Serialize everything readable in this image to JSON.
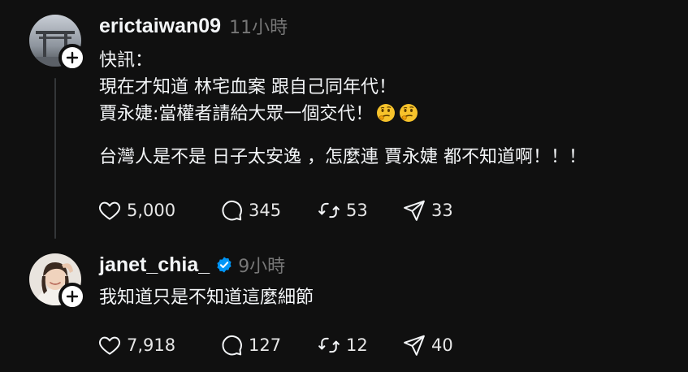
{
  "colors": {
    "background": "#101010",
    "text_primary": "#f3f5f7",
    "text_secondary": "#777777",
    "verified_badge": "#0095f6",
    "thread_line": "#333638"
  },
  "posts": [
    {
      "username": "erictaiwan09",
      "timestamp": "11小時",
      "verified": false,
      "avatar_icon": "torii-gate-photo",
      "lines": [
        "快訊：",
        "現在才知道 林宅血案 跟自己同年代！",
        "賈永婕:當權者請給大眾一個交代！",
        "",
        "台灣人是不是 日子太安逸 ，怎麼連 賈永婕 都不知道啊！！！"
      ],
      "emoji": [
        "thinking-face",
        "thinking-face"
      ],
      "likes": "5,000",
      "comments": "345",
      "reposts": "53",
      "shares": "33"
    },
    {
      "username": "janet_chia_",
      "timestamp": "9小時",
      "verified": true,
      "avatar_icon": "user-photo",
      "lines": [
        "我知道只是不知道這麼細節"
      ],
      "likes": "7,918",
      "comments": "127",
      "reposts": "12",
      "shares": "40"
    }
  ]
}
